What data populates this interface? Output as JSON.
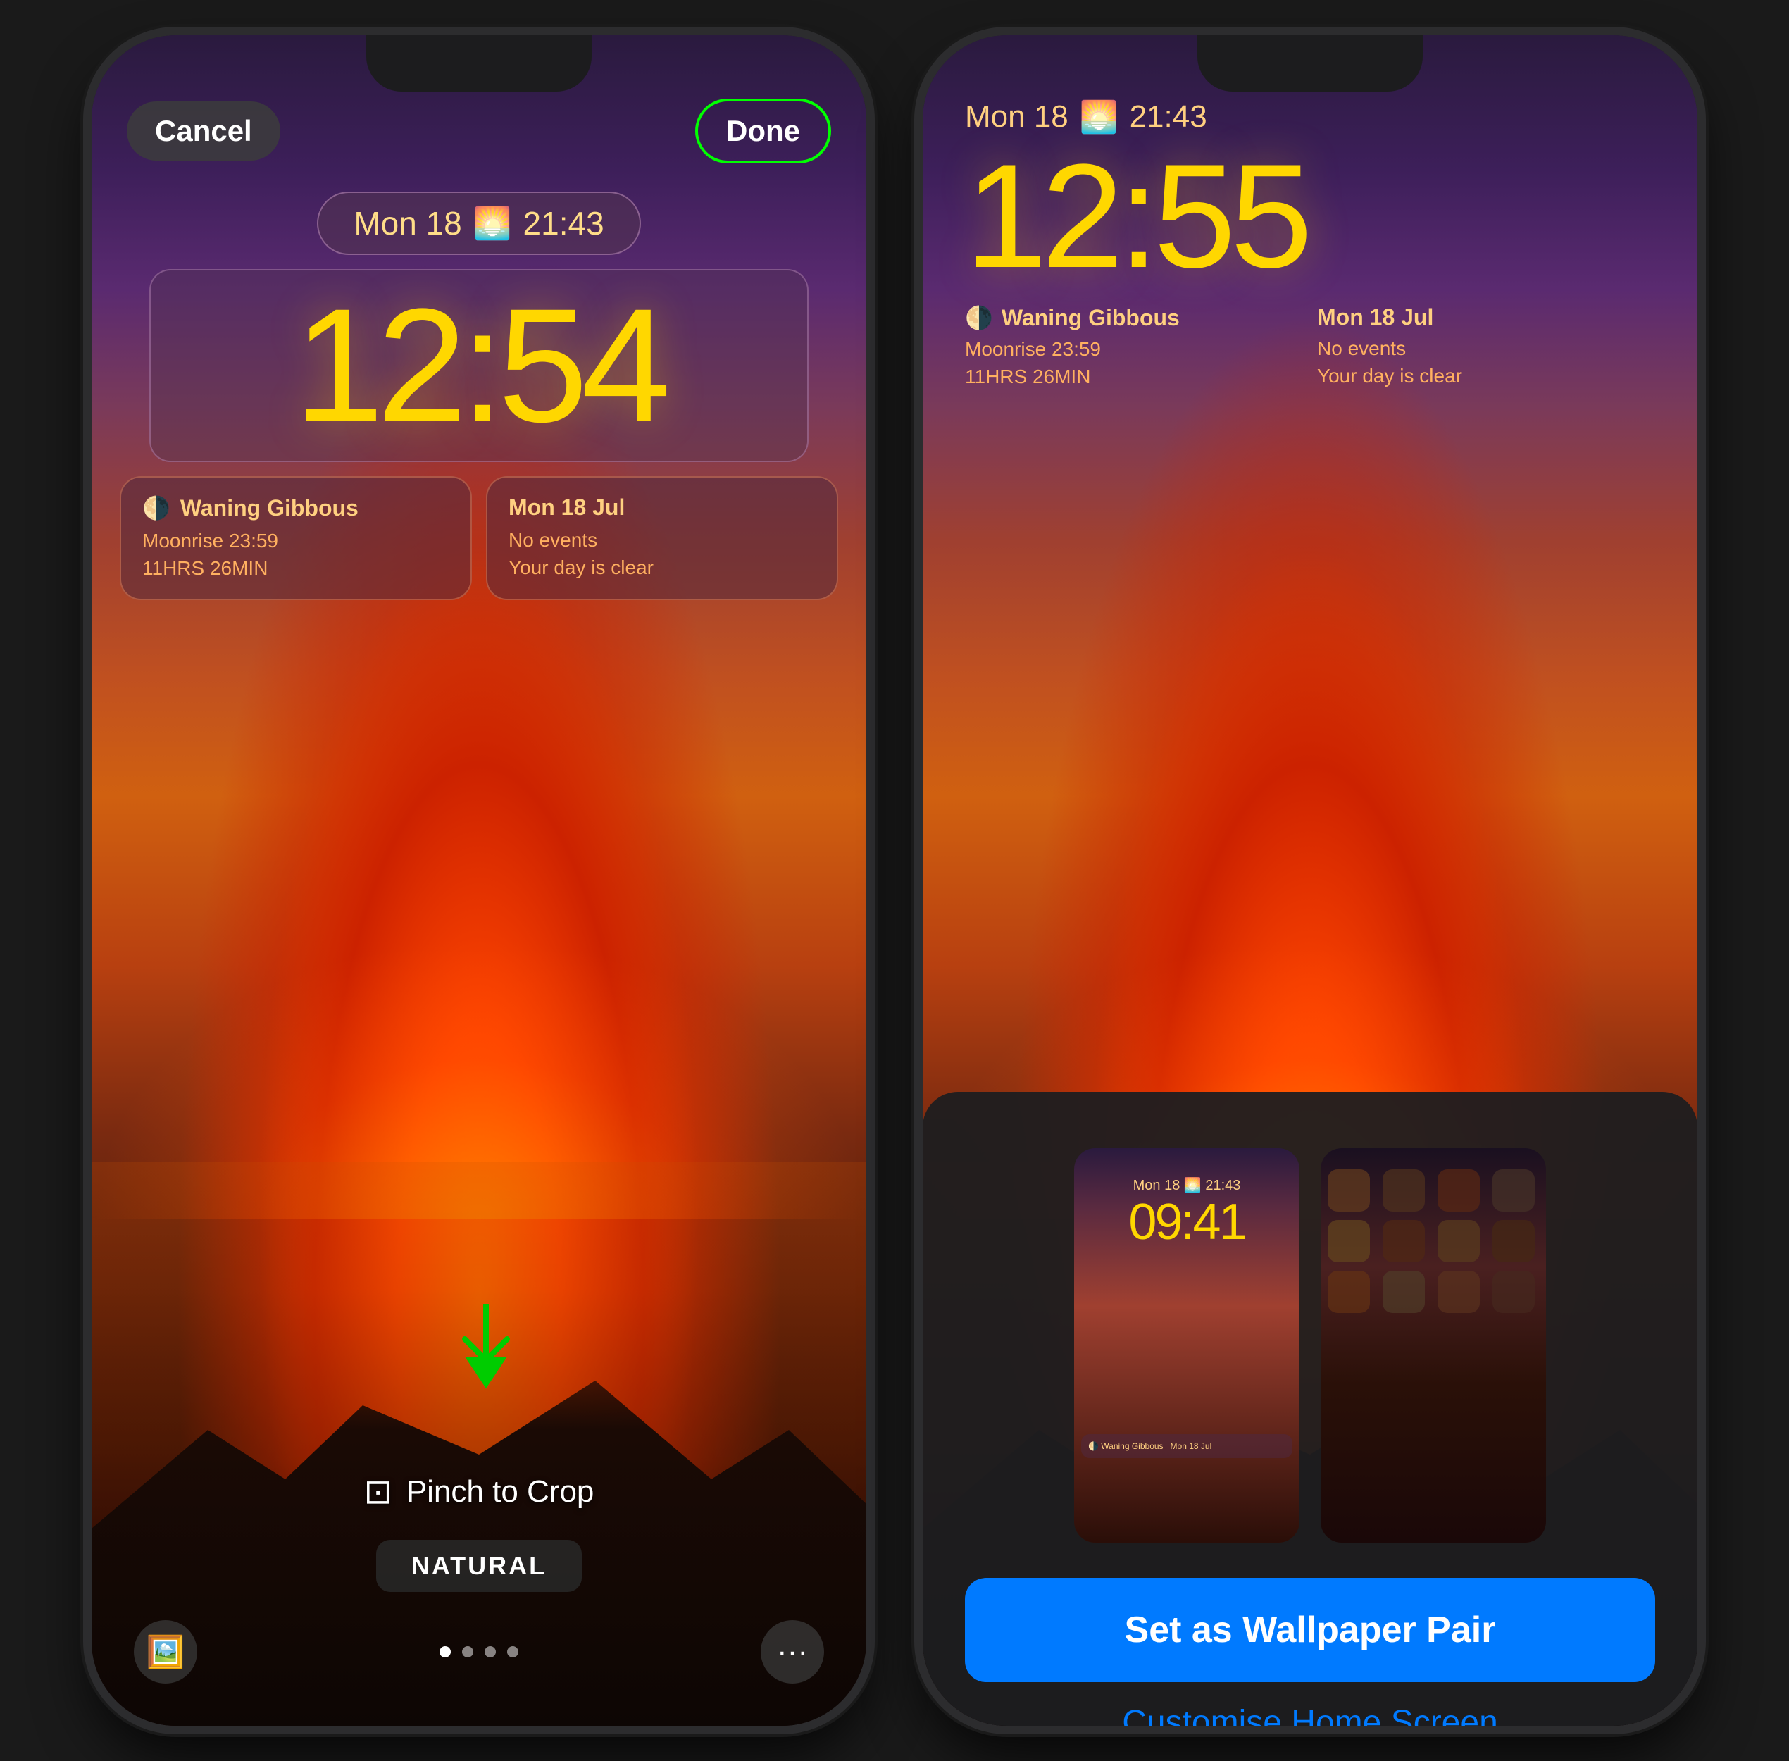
{
  "left_phone": {
    "cancel_label": "Cancel",
    "done_label": "Done",
    "date_text": "Mon 18",
    "time_text": "21:43",
    "clock_time": "12:54",
    "widget_left": {
      "icon": "🌗",
      "title": "Waning Gibbous",
      "line1": "Moonrise 23:59",
      "line2": "11HRS 26MIN"
    },
    "widget_right": {
      "title": "Mon 18 Jul",
      "line1": "No events",
      "line2": "Your day is clear"
    },
    "pinch_label": "Pinch to Crop",
    "natural_label": "NATURAL",
    "toolbar": {
      "photos_icon": "🖼",
      "more_icon": "•••"
    }
  },
  "right_phone": {
    "date_text": "Mon 18",
    "time_text": "21:43",
    "clock_time": "12:55",
    "widget_left": {
      "icon": "🌗",
      "title": "Waning Gibbous",
      "line1": "Moonrise 23:59",
      "line2": "11HRS 26MIN"
    },
    "widget_right": {
      "title": "Mon 18 Jul",
      "line1": "No events",
      "line2": "Your day is clear"
    },
    "preview_lock_time": "09:41",
    "set_wallpaper_label": "Set as Wallpaper Pair",
    "customise_label": "Customise Home Screen"
  }
}
